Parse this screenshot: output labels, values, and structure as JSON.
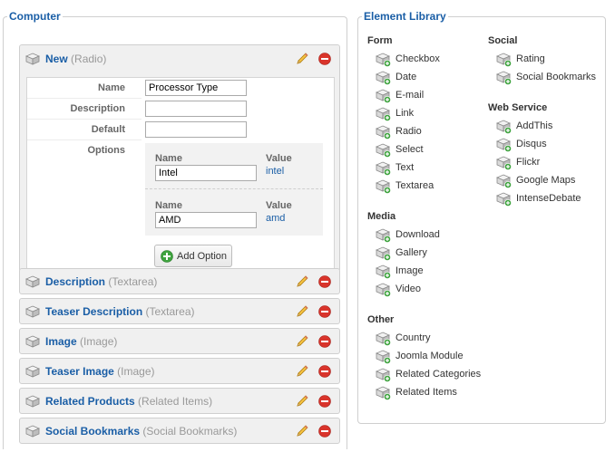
{
  "computer": {
    "legend": "Computer",
    "new_panel": {
      "title": "New",
      "type": "(Radio)",
      "fields": {
        "name_label": "Name",
        "name_value": "Processor Type",
        "description_label": "Description",
        "description_value": "",
        "default_label": "Default",
        "default_value": "",
        "options_label": "Options"
      },
      "options": [
        {
          "name_header": "Name",
          "value_header": "Value",
          "name": "Intel",
          "value": "intel"
        },
        {
          "name_header": "Name",
          "value_header": "Value",
          "name": "AMD",
          "value": "amd"
        }
      ],
      "add_option_label": "Add Option"
    },
    "elements": [
      {
        "title": "Description",
        "type": "(Textarea)"
      },
      {
        "title": "Teaser Description",
        "type": "(Textarea)"
      },
      {
        "title": "Image",
        "type": "(Image)"
      },
      {
        "title": "Teaser Image",
        "type": "(Image)"
      },
      {
        "title": "Related Products",
        "type": "(Related Items)"
      },
      {
        "title": "Social Bookmarks",
        "type": "(Social Bookmarks)"
      }
    ]
  },
  "library": {
    "legend": "Element Library",
    "form": {
      "heading": "Form",
      "items": [
        "Checkbox",
        "Date",
        "E-mail",
        "Link",
        "Radio",
        "Select",
        "Text",
        "Textarea"
      ]
    },
    "media": {
      "heading": "Media",
      "items": [
        "Download",
        "Gallery",
        "Image",
        "Video"
      ]
    },
    "other": {
      "heading": "Other",
      "items": [
        "Country",
        "Joomla Module",
        "Related Categories",
        "Related Items"
      ]
    },
    "social": {
      "heading": "Social",
      "items": [
        "Rating",
        "Social Bookmarks"
      ]
    },
    "web_service": {
      "heading": "Web Service",
      "items": [
        "AddThis",
        "Disqus",
        "Flickr",
        "Google Maps",
        "IntenseDebate"
      ]
    }
  },
  "icons": {
    "element": "cube-icon",
    "library_item": "cube-add-icon",
    "edit": "pencil-icon",
    "delete": "delete-icon",
    "add": "plus-circle-icon"
  },
  "colors": {
    "accent": "#1a5ea6",
    "panel_bg": "#f0f0f0",
    "delete_red": "#d9342b",
    "add_green": "#3fa33f"
  }
}
